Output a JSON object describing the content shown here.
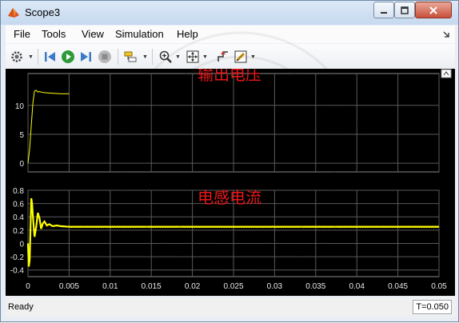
{
  "window": {
    "title": "Scope3"
  },
  "menu": {
    "file": "File",
    "tools": "Tools",
    "view": "View",
    "simulation": "Simulation",
    "help": "Help"
  },
  "status": {
    "text": "Ready",
    "time": "T=0.050"
  },
  "colors": {
    "plot_bg": "#000000",
    "axes_bg": "#000000",
    "trace": "#ffff00",
    "grid": "#5a5a5a",
    "tick_text": "#e8e8e8",
    "annotation": "#e8171a"
  },
  "chart_data": [
    {
      "type": "line",
      "title": "输出电压",
      "xlim": [
        0,
        0.05
      ],
      "ylim": [
        -1.5,
        15.5
      ],
      "yticks": [
        0,
        5,
        10
      ],
      "xticks": [
        0,
        0.005,
        0.01,
        0.015,
        0.02,
        0.025,
        0.03,
        0.035,
        0.04,
        0.045,
        0.05
      ],
      "grid": true,
      "series": [
        {
          "x": [
            0,
            0.0002,
            0.0004,
            0.0006,
            0.0008,
            0.001,
            0.0012,
            0.0014,
            0.0016,
            0.002,
            0.003,
            0.004,
            0.005
          ],
          "y": [
            0,
            2.5,
            6.5,
            10.5,
            12.5,
            12.6,
            12.3,
            12.4,
            12.3,
            12.2,
            12.1,
            12.0,
            12.0
          ]
        }
      ]
    },
    {
      "type": "line",
      "title": "电感电流",
      "xlim": [
        0,
        0.05
      ],
      "ylim": [
        -0.5,
        0.8
      ],
      "yticks": [
        0.8,
        0.6,
        0.4,
        0.2,
        0,
        -0.2,
        -0.4
      ],
      "ytick_labels": [
        "0.8",
        "0.6",
        "0.4",
        "0.2",
        "0",
        "-0.2",
        "-0.4"
      ],
      "xticks": [
        0,
        0.005,
        0.01,
        0.015,
        0.02,
        0.025,
        0.03,
        0.035,
        0.04,
        0.045,
        0.05
      ],
      "xtick_labels": [
        "0",
        "0.005",
        "0.01",
        "0.015",
        "0.02",
        "0.025",
        "0.03",
        "0.035",
        "0.04",
        "0.045",
        "0.05"
      ],
      "grid": true,
      "series": [
        {
          "x": [
            0,
            0.0001,
            0.0002,
            0.0003,
            0.0004,
            0.0005,
            0.0006,
            0.0008,
            0.001,
            0.0012,
            0.0014,
            0.0016,
            0.0018,
            0.002,
            0.0023,
            0.0026,
            0.003,
            0.0035,
            0.004,
            0.005,
            0.05
          ],
          "y": [
            0,
            -0.35,
            -0.25,
            0.2,
            0.68,
            0.6,
            0.4,
            0.1,
            0.25,
            0.46,
            0.38,
            0.22,
            0.3,
            0.33,
            0.27,
            0.29,
            0.26,
            0.27,
            0.26,
            0.25,
            0.25
          ]
        }
      ]
    }
  ]
}
